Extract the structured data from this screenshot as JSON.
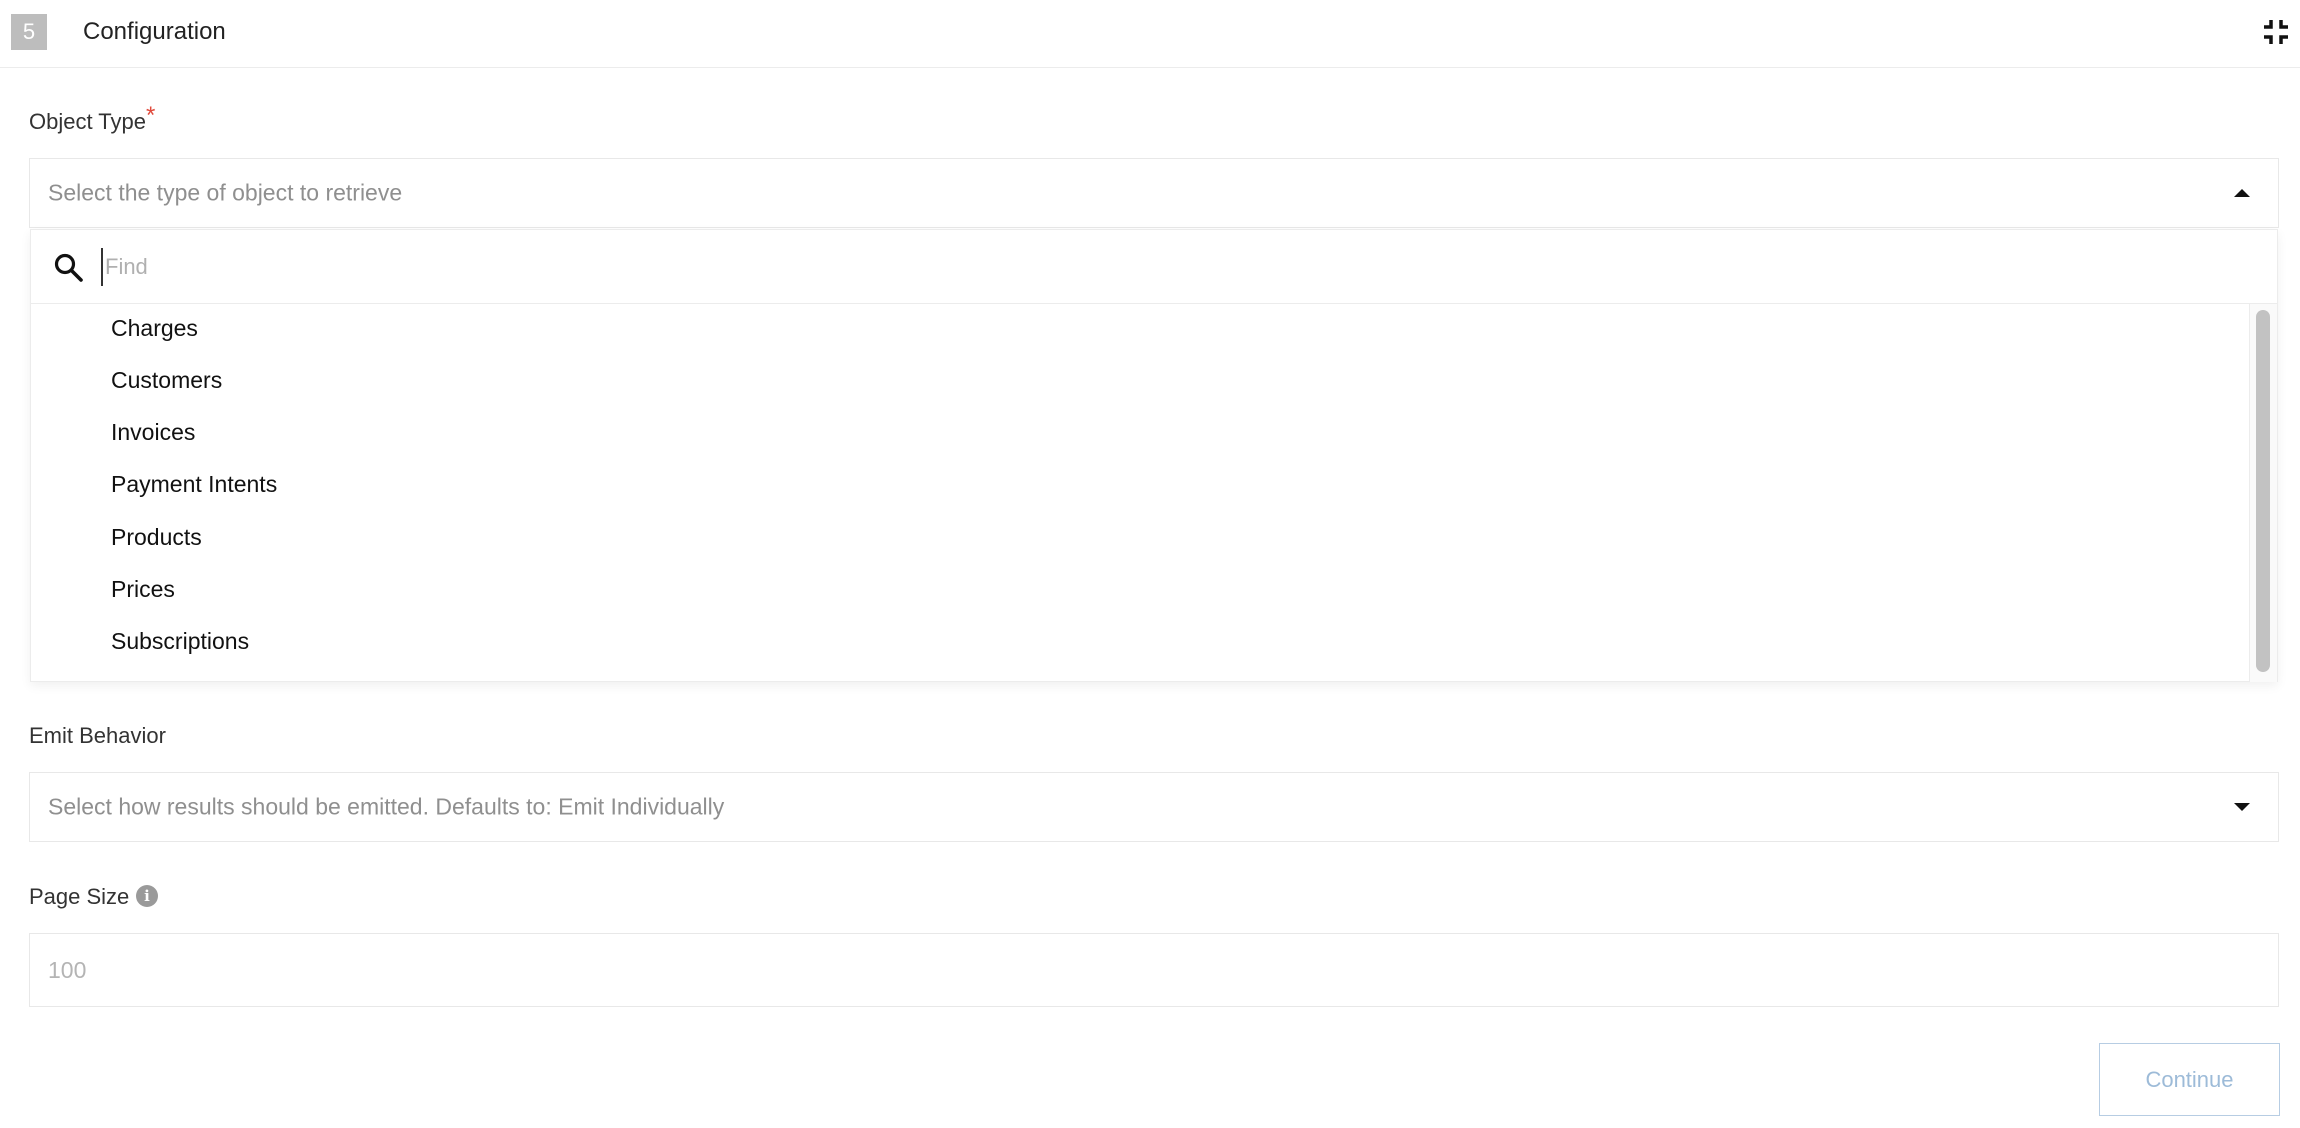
{
  "header": {
    "step_number": "5",
    "title": "Configuration",
    "collapse_icon": "collapse-icon"
  },
  "object_type": {
    "label": "Object Type",
    "required_mark": "*",
    "placeholder": "Select the type of object to retrieve",
    "dropdown_open": true,
    "find_placeholder": "Find",
    "options": [
      "Charges",
      "Customers",
      "Invoices",
      "Payment Intents",
      "Products",
      "Prices",
      "Subscriptions"
    ]
  },
  "emit_behavior": {
    "label": "Emit Behavior",
    "placeholder": "Select how results should be emitted. Defaults to: Emit Individually"
  },
  "page_size": {
    "label": "Page Size",
    "placeholder": "100",
    "info_icon": "info-icon"
  },
  "actions": {
    "continue_label": "Continue"
  },
  "colors": {
    "required": "#e04a3c",
    "continue_text": "#9dbbd8",
    "continue_border": "#b7cde3",
    "step_badge": "#bdbdbd"
  }
}
